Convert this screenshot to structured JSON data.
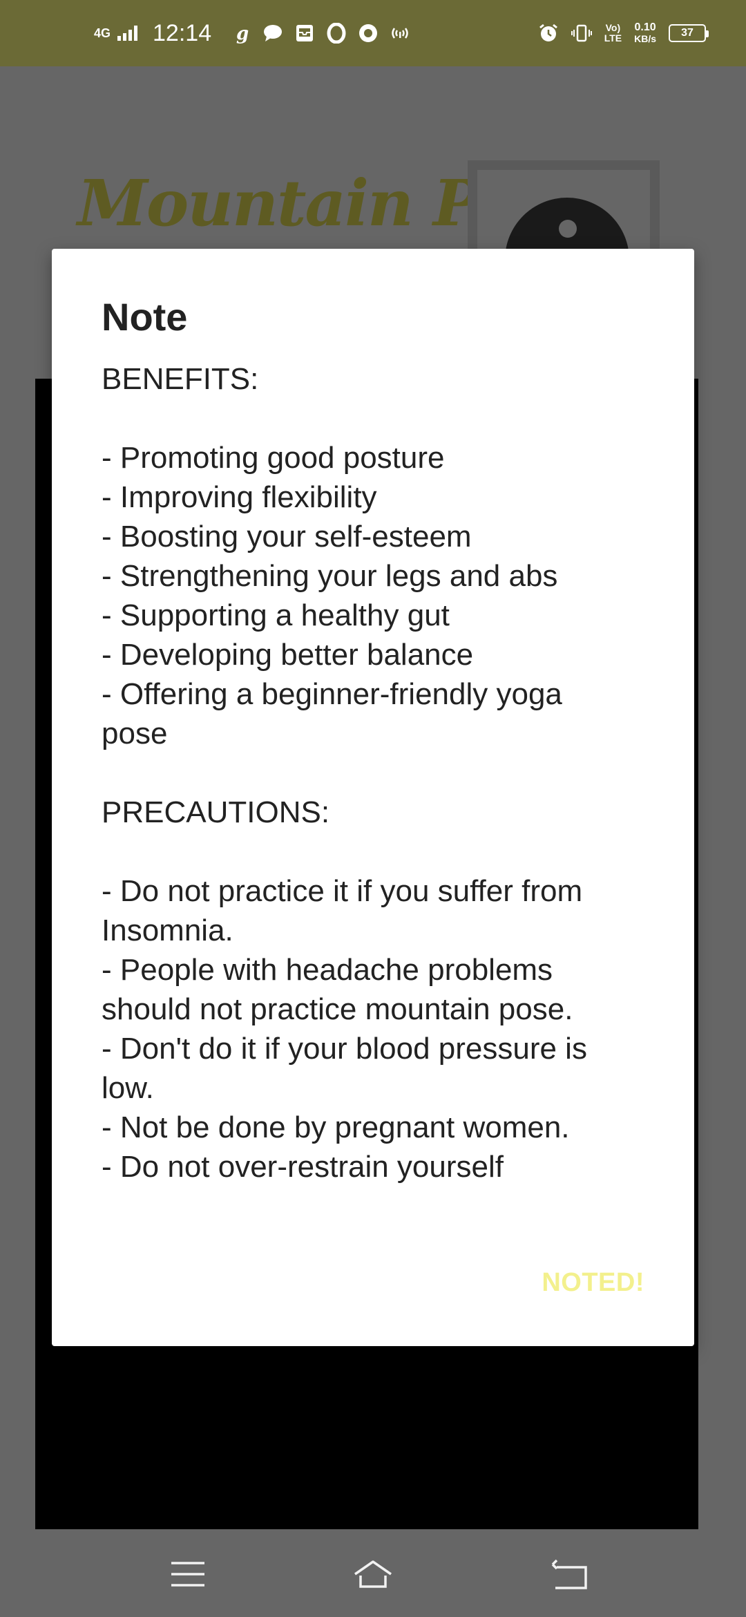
{
  "status_bar": {
    "network": "4G",
    "time": "12:14",
    "volte_top": "Vo)",
    "volte_bottom": "LTE",
    "speed_top": "0.10",
    "speed_bottom": "KB/s",
    "battery": "37",
    "icons_left": [
      "goibibo-icon",
      "chat-bubble-icon",
      "inbox-icon",
      "opera-icon",
      "circle-app-icon",
      "hotspot-icon"
    ],
    "icons_right": [
      "alarm-icon",
      "vibrate-icon"
    ]
  },
  "background": {
    "title": "Mountain Pose",
    "title_color": "#5e5b22"
  },
  "dialog": {
    "title": "Note",
    "benefits_heading": "BENEFITS:",
    "benefits": [
      "- Promoting good posture",
      "- Improving flexibility",
      "- Boosting your self-esteem",
      "- Strengthening your legs and abs",
      "- Supporting a healthy gut",
      "- Developing better balance",
      "- Offering a beginner-friendly yoga pose"
    ],
    "precautions_heading": "PRECAUTIONS:",
    "precautions": [
      "- Do not practice it if you suffer from Insomnia.",
      "- People with headache problems should not practice mountain pose.",
      "- Don't do it if your blood pressure is low.",
      "- Not be done by pregnant women.",
      "- Do not over-restrain yourself"
    ],
    "button_label": "NOTED!",
    "button_color": "#f3f08d"
  },
  "nav_bar": {
    "buttons": [
      "menu-icon",
      "home-icon",
      "back-icon"
    ]
  },
  "colors": {
    "status_bar": "#6b6a36",
    "scrim": "#666666",
    "dialog_bg": "#ffffff"
  }
}
